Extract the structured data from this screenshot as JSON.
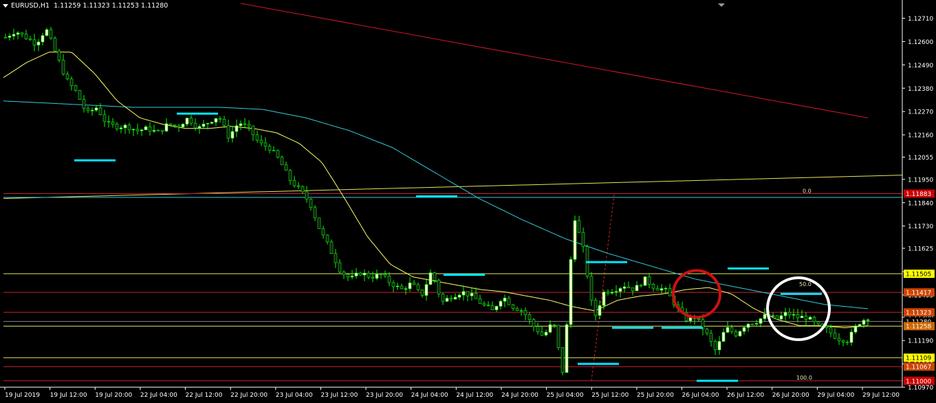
{
  "header": {
    "symbol": "EURUSD,H1",
    "ohlc": "1.11259 1.11323 1.11253 1.11280"
  },
  "colors": {
    "background": "#000000",
    "bull_candle": "#ffffcc",
    "bear_candle": "#1a1a1a",
    "wick": "#00ff00",
    "ma_fast": "#ffff66",
    "ma_slow": "#33ccdd",
    "trend_red": "#cc1a2a",
    "trend_yellow": "#e6e65a",
    "level_marker": "#00e6ff",
    "circle_red": "#cc1111",
    "circle_white": "#ffffff"
  },
  "chart_data": {
    "type": "candlestick",
    "title": "EURUSD,H1",
    "ylim": [
      1.1097,
      1.1277
    ],
    "y_ticks": [
      "1.12710",
      "1.12600",
      "1.12490",
      "1.12380",
      "1.12270",
      "1.12160",
      "1.12055",
      "1.11950",
      "1.11840",
      "1.11730",
      "1.11625",
      "1.11515",
      "1.11405",
      "1.11300",
      "1.11190",
      "1.11080",
      "1.10970"
    ],
    "x_labels": [
      "19 Jul 2019",
      "19 Jul 12:00",
      "19 Jul 20:00",
      "22 Jul 04:00",
      "22 Jul 12:00",
      "22 Jul 20:00",
      "23 Jul 04:00",
      "23 Jul 12:00",
      "23 Jul 20:00",
      "24 Jul 04:00",
      "24 Jul 12:00",
      "24 Jul 20:00",
      "25 Jul 04:00",
      "25 Jul 12:00",
      "25 Jul 20:00",
      "26 Jul 04:00",
      "26 Jul 12:00",
      "26 Jul 20:00",
      "29 Jul 04:00",
      "29 Jul 12:00"
    ],
    "close_path": [
      1.1262,
      1.1265,
      1.1262,
      1.1259,
      1.1266,
      1.1254,
      1.1242,
      1.1236,
      1.1226,
      1.1229,
      1.1221,
      1.122,
      1.122,
      1.1218,
      1.1219,
      1.1217,
      1.1221,
      1.122,
      1.1224,
      1.1219,
      1.1222,
      1.1225,
      1.1215,
      1.1222,
      1.1219,
      1.1212,
      1.121,
      1.1204,
      1.1195,
      1.119,
      1.1184,
      1.1171,
      1.1162,
      1.1152,
      1.1148,
      1.1151,
      1.1149,
      1.115,
      1.1146,
      1.1143,
      1.1146,
      1.114,
      1.1152,
      1.1137,
      1.114,
      1.1142,
      1.114,
      1.1136,
      1.1133,
      1.114,
      1.1135,
      1.1133,
      1.1126,
      1.1121,
      1.1128,
      1.1102,
      1.1179,
      1.1161,
      1.1129,
      1.1142,
      1.1143,
      1.1145,
      1.1143,
      1.1148,
      1.1144,
      1.1143,
      1.1136,
      1.1129,
      1.113,
      1.1123,
      1.1114,
      1.1125,
      1.1122,
      1.1127,
      1.1128,
      1.1131,
      1.1129,
      1.1132,
      1.113,
      1.113,
      1.1126,
      1.1124,
      1.112,
      1.1119,
      1.1127,
      1.113
    ],
    "ma_fast_path": [
      1.1243,
      1.125,
      1.1255,
      1.1255,
      1.1245,
      1.1232,
      1.1224,
      1.1221,
      1.1219,
      1.1219,
      1.122,
      1.1219,
      1.1217,
      1.1212,
      1.1203,
      1.1186,
      1.1168,
      1.1155,
      1.1149,
      1.1147,
      1.1145,
      1.1143,
      1.1142,
      1.114,
      1.1138,
      1.1135,
      1.1133,
      1.1138,
      1.114,
      1.1141,
      1.1143,
      1.1144,
      1.1141,
      1.1134,
      1.1129,
      1.1126,
      1.1126,
      1.1125,
      1.1126
    ],
    "ma_slow_path": [
      1.1232,
      1.1231,
      1.123,
      1.1229,
      1.1229,
      1.1229,
      1.1228,
      1.1224,
      1.1218,
      1.121,
      1.1198,
      1.1186,
      1.1176,
      1.1167,
      1.116,
      1.1154,
      1.1148,
      1.1144,
      1.114,
      1.1136,
      1.1134
    ],
    "trend_red": [
      1.1278,
      1.1224
    ],
    "trend_yellow": [
      1.1186,
      1.1197
    ],
    "levels": [
      {
        "value": 1.11883,
        "label": "1.11883",
        "line_color": "#cc2233",
        "label_bg": "#cc0000",
        "label_fg": "#ffffff"
      },
      {
        "value": 1.11505,
        "label": "1.11505",
        "line_color": "#e6e65a",
        "label_bg": "#ffff00",
        "label_fg": "#000000"
      },
      {
        "value": 1.11417,
        "label": "1.11417",
        "line_color": "#cc2233",
        "label_bg": "#cc4400",
        "label_fg": "#ffffff"
      },
      {
        "value": 1.11323,
        "label": "1.11323",
        "line_color": "#cc2233",
        "label_bg": "#cc4400",
        "label_fg": "#ffffff"
      },
      {
        "value": 1.1128,
        "label": "1.11280",
        "line_color": "#888888",
        "label_bg": "#000000",
        "label_fg": "#ffffff"
      },
      {
        "value": 1.11258,
        "label": "1.11258",
        "line_color": "#e6e65a",
        "label_bg": "#cc6600",
        "label_fg": "#ffffff"
      },
      {
        "value": 1.11109,
        "label": "1.11109",
        "line_color": "#e6e65a",
        "label_bg": "#ffff00",
        "label_fg": "#000000"
      },
      {
        "value": 1.11067,
        "label": "1.11067",
        "line_color": "#cc2233",
        "label_bg": "#cc4400",
        "label_fg": "#ffffff"
      },
      {
        "value": 1.11,
        "label": "1.11000",
        "line_color": "#cc2233",
        "label_bg": "#cc0000",
        "label_fg": "#ffffff"
      }
    ],
    "fib_labels": [
      {
        "text": "0.0",
        "value": 1.1188
      },
      {
        "text": "50.0",
        "value": 1.1144
      },
      {
        "text": "100.0",
        "value": 1.11
      }
    ],
    "markers": [
      1.1204,
      1.1226,
      1.1187,
      1.115,
      1.1156,
      1.1125,
      1.1125,
      1.1153,
      1.1141,
      1.1108,
      1.11
    ]
  }
}
